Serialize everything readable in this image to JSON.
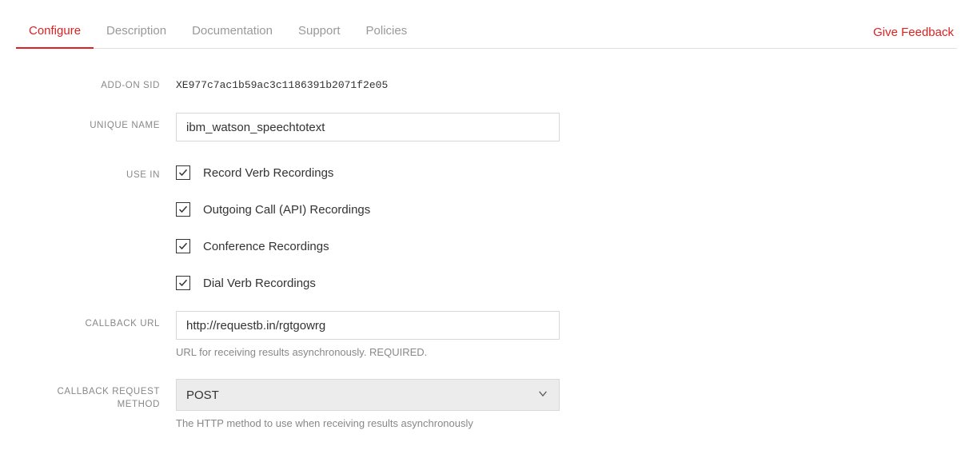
{
  "tabs": {
    "items": [
      {
        "label": "Configure",
        "active": true
      },
      {
        "label": "Description",
        "active": false
      },
      {
        "label": "Documentation",
        "active": false
      },
      {
        "label": "Support",
        "active": false
      },
      {
        "label": "Policies",
        "active": false
      }
    ],
    "feedback_label": "Give Feedback"
  },
  "form": {
    "addon_sid": {
      "label": "ADD-ON SID",
      "value": "XE977c7ac1b59ac3c1186391b2071f2e05"
    },
    "unique_name": {
      "label": "UNIQUE NAME",
      "value": "ibm_watson_speechtotext"
    },
    "use_in": {
      "label": "USE IN",
      "options": [
        {
          "label": "Record Verb Recordings",
          "checked": true
        },
        {
          "label": "Outgoing Call (API) Recordings",
          "checked": true
        },
        {
          "label": "Conference Recordings",
          "checked": true
        },
        {
          "label": "Dial Verb Recordings",
          "checked": true
        }
      ]
    },
    "callback_url": {
      "label": "CALLBACK URL",
      "value": "http://requestb.in/rgtgowrg",
      "helper": "URL for receiving results asynchronously. REQUIRED."
    },
    "callback_method": {
      "label": "CALLBACK REQUEST METHOD",
      "value": "POST",
      "helper": "The HTTP method to use when receiving results asynchronously"
    }
  }
}
